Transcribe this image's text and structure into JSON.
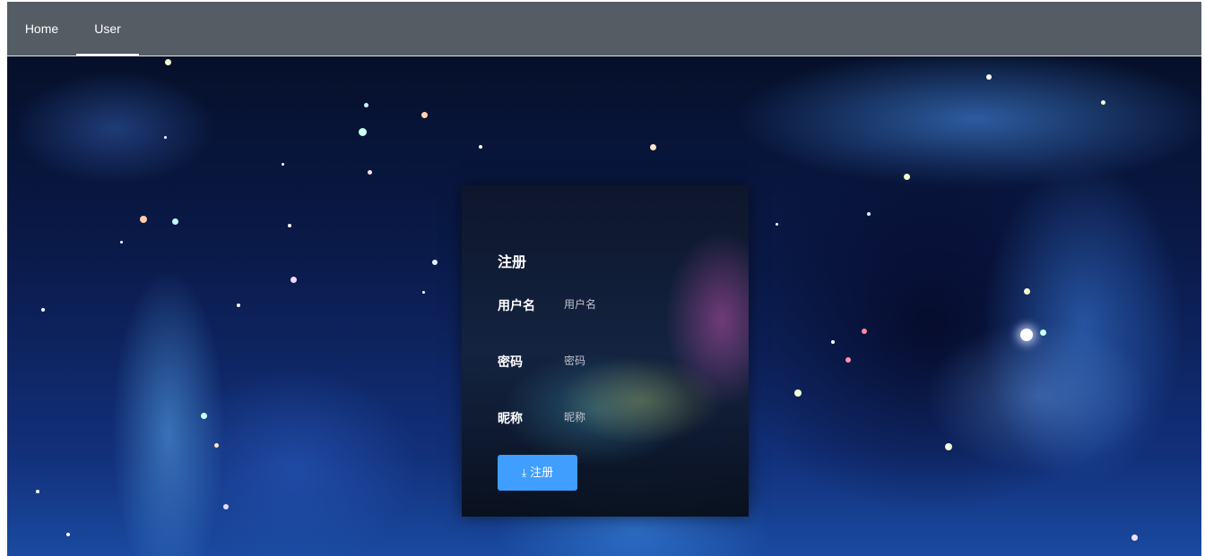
{
  "nav": {
    "home_label": "Home",
    "user_label": "User"
  },
  "form": {
    "title": "注册",
    "username": {
      "label": "用户名",
      "placeholder": "用户名"
    },
    "password": {
      "label": "密码",
      "placeholder": "密码"
    },
    "nickname": {
      "label": "昵称",
      "placeholder": "昵称"
    },
    "submit_label": "注册",
    "submit_icon": "download-icon"
  },
  "colors": {
    "navbar": "#545c64",
    "primary": "#409eff"
  }
}
